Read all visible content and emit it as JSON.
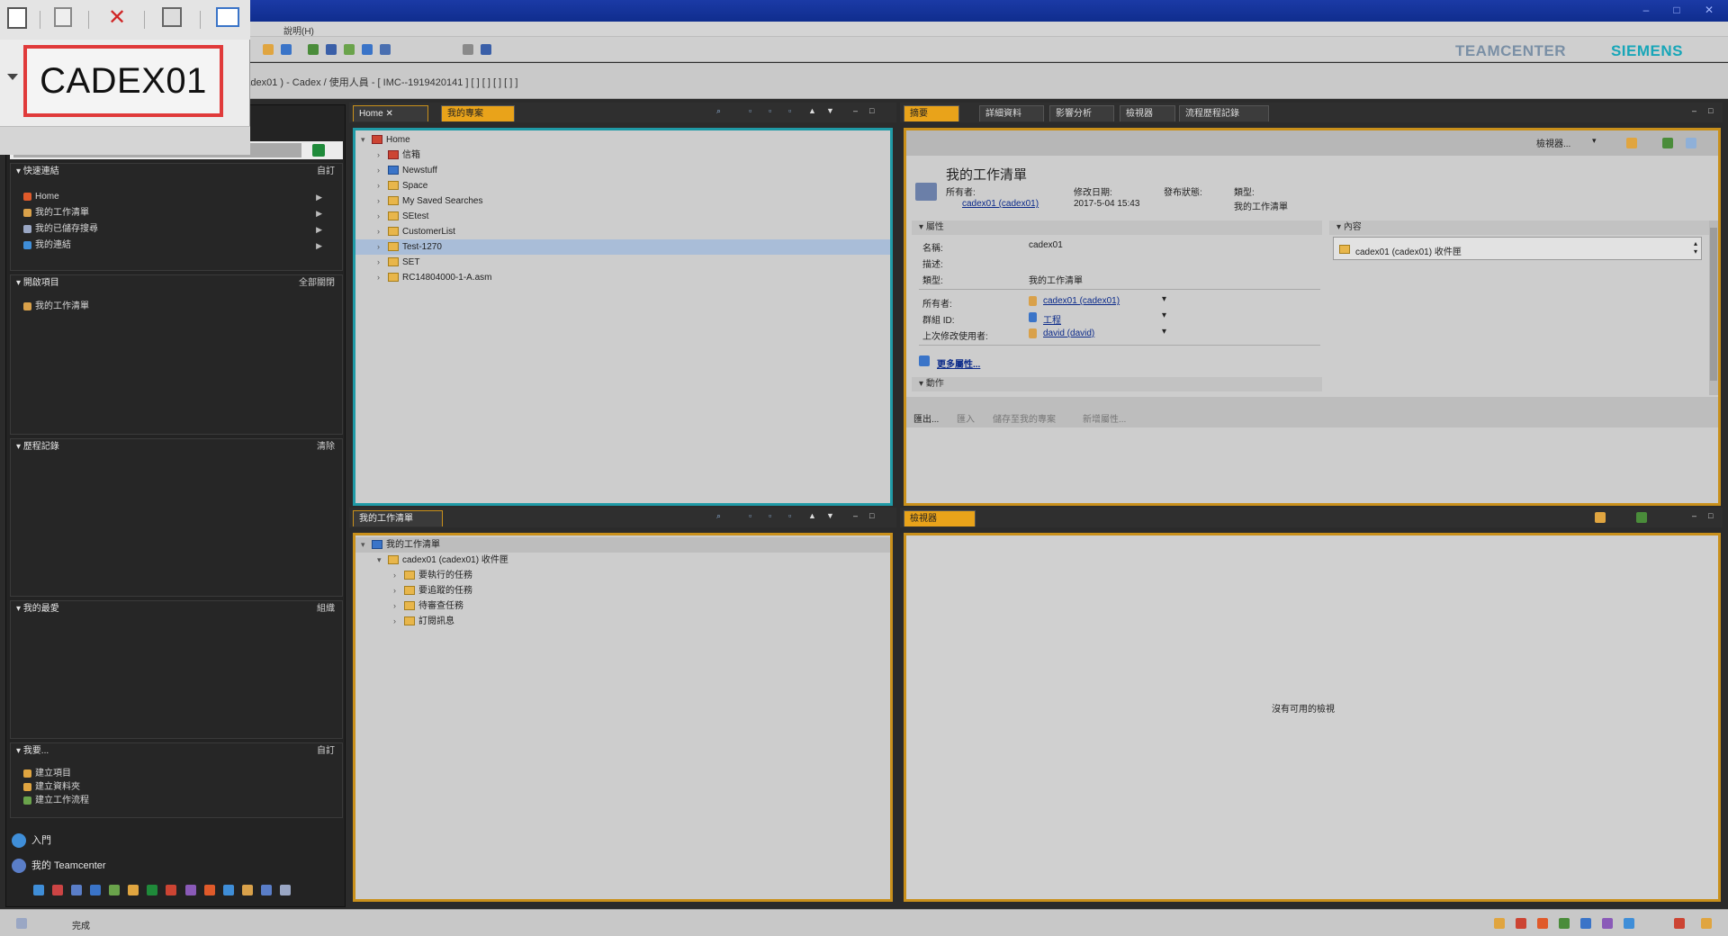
{
  "window": {
    "minimize": "–",
    "maximize": "□",
    "close": "✕"
  },
  "menu": {
    "items": [
      "說明(H)"
    ]
  },
  "brand": {
    "teamcenter": "TEAMCENTER",
    "siemens": "SIEMENS"
  },
  "zoom": {
    "label": "CADEX01"
  },
  "address": {
    "text": "( cadex01 ) - Cadex / 使用人員 - [ IMC--1919420141 ] [ ] [ ] [ ] [ ] ]"
  },
  "nav": {
    "sections": [
      {
        "title": "快速連結",
        "action": "自訂",
        "items": [
          {
            "label": "Home",
            "color": "#e05a2a"
          },
          {
            "label": "我的工作清單",
            "color": "#d9a14a"
          },
          {
            "label": "我的已儲存搜尋",
            "color": "#9aa7c4"
          },
          {
            "label": "我的連結",
            "color": "#3f8ed8"
          }
        ]
      },
      {
        "title": "開啟項目",
        "action": "全部關閉",
        "items": [
          {
            "label": "我的工作清單",
            "color": "#d9a14a"
          }
        ]
      },
      {
        "title": "歷程記錄",
        "action": "清除",
        "items": []
      },
      {
        "title": "我的最愛",
        "action": "組織",
        "items": []
      },
      {
        "title": "我要...",
        "action": "自訂",
        "items": [
          {
            "label": "建立項目",
            "color": "#e0a540"
          },
          {
            "label": "建立資料夾",
            "color": "#e0a540"
          },
          {
            "label": "建立工作流程",
            "color": "#6aa34b"
          }
        ]
      }
    ],
    "bottom": {
      "link1": "入門",
      "link2": "我的 Teamcenter"
    }
  },
  "home_pane": {
    "tabs": [
      "Home",
      "我的專案"
    ],
    "tree": [
      {
        "label": "Home",
        "level": 0,
        "expanded": true,
        "icon": "red"
      },
      {
        "label": "信箱",
        "level": 1,
        "icon": "red"
      },
      {
        "label": "Newstuff",
        "level": 1,
        "icon": "blue"
      },
      {
        "label": "Space",
        "level": 1,
        "icon": "folder"
      },
      {
        "label": "My Saved Searches",
        "level": 1,
        "icon": "folder"
      },
      {
        "label": "SEtest",
        "level": 1,
        "icon": "folder"
      },
      {
        "label": "CustomerList",
        "level": 1,
        "icon": "folder"
      },
      {
        "label": "Test-1270",
        "level": 1,
        "icon": "folder",
        "selected": true
      },
      {
        "label": "SET",
        "level": 1,
        "icon": "folder"
      },
      {
        "label": "RC14804000-1-A.asm",
        "level": 1,
        "icon": "folder"
      }
    ]
  },
  "worklist_pane": {
    "tab": "我的工作清單",
    "tree": [
      {
        "label": "我的工作清單",
        "level": 0,
        "expanded": true
      },
      {
        "label": "cadex01 (cadex01) 收件匣",
        "level": 1,
        "expanded": true
      },
      {
        "label": "要執行的任務",
        "level": 2
      },
      {
        "label": "要追蹤的任務",
        "level": 2
      },
      {
        "label": "待審查任務",
        "level": 2
      },
      {
        "label": "訂閱訊息",
        "level": 2
      }
    ]
  },
  "summary_pane": {
    "tabs": [
      "摘要",
      "詳細資料",
      "影響分析",
      "檢視器",
      "流程歷程記錄"
    ],
    "toolbar_label": "檢視器...",
    "title": "我的工作清單",
    "header_fields": {
      "owner_label": "所有者:",
      "owner_value": "cadex01 (cadex01)",
      "modified_label": "修改日期:",
      "modified_value": "2017-5-04 15:43",
      "release_label": "發布狀態:",
      "type_label": "類型:",
      "type_value": "我的工作清單"
    },
    "properties": {
      "section": "屬性",
      "name_label": "名稱:",
      "name_value": "cadex01",
      "desc_label": "描述:",
      "type_label": "類型:",
      "type_value": "我的工作清單",
      "owner_label": "所有者:",
      "owner_value": "cadex01 (cadex01)",
      "group_label": "群組 ID:",
      "group_value": "工程",
      "lastmod_label": "上次修改使用者:",
      "lastmod_value": "david (david)",
      "more_link": "更多屬性..."
    },
    "content": {
      "section": "內容",
      "item": "cadex01 (cadex01) 收件匣"
    },
    "actions": {
      "section": "動作",
      "buttons": [
        "匯出...",
        "匯入",
        "儲存至我的專案",
        "新增屬性..."
      ]
    }
  },
  "viewer_pane": {
    "tab": "檢視器",
    "empty_message": "沒有可用的檢視"
  },
  "status": {
    "text": "完成"
  }
}
